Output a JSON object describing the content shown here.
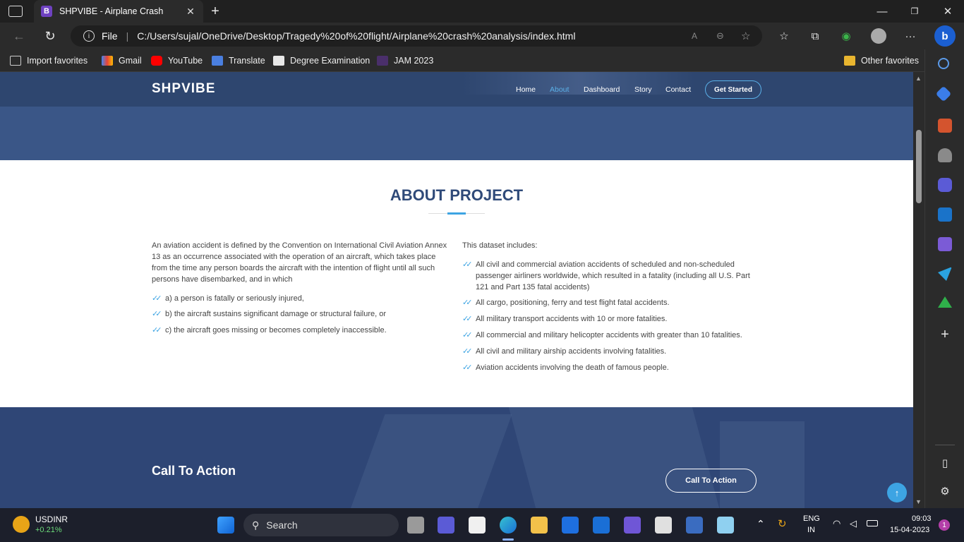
{
  "browser": {
    "tab_title": "SHPVIBE - Airplane Crash",
    "tab_favicon_letter": "B",
    "url_scheme": "File",
    "url": "C:/Users/sujal/OneDrive/Desktop/Tragedy%20of%20flight/Airplane%20crash%20analysis/index.html",
    "favorites": [
      "Import favorites",
      "Gmail",
      "YouTube",
      "Translate",
      "Degree Examination",
      "JAM 2023"
    ],
    "other_favorites": "Other favorites"
  },
  "site": {
    "logo": "SHPVIBE",
    "nav": [
      "Home",
      "About",
      "Dashboard",
      "Story",
      "Contact"
    ],
    "active_nav": "About",
    "cta_nav": "Get Started",
    "about_title": "ABOUT PROJECT",
    "left_para": "An aviation accident is defined by the Convention on International Civil Aviation Annex 13 as an occurrence associated with the operation of an aircraft, which takes place from the time any person boards the aircraft with the intention of flight until all such persons have disembarked, and in which",
    "left_items": [
      "a) a person is fatally or seriously injured,",
      "b) the aircraft sustains significant damage or structural failure, or",
      "c) the aircraft goes missing or becomes completely inaccessible."
    ],
    "right_intro": "This dataset includes:",
    "right_items": [
      "All civil and commercial aviation accidents of scheduled and non-scheduled passenger airliners worldwide, which resulted in a fatality (including all U.S. Part 121 and Part 135 fatal accidents)",
      "All cargo, positioning, ferry and test flight fatal accidents.",
      "All military transport accidents with 10 or more fatalities.",
      "All commercial and military helicopter accidents with greater than 10 fatalities.",
      "All civil and military airship accidents involving fatalities.",
      "Aviation accidents involving the death of famous people."
    ],
    "cta_title": "Call To Action",
    "cta_button": "Call To Action"
  },
  "taskbar": {
    "ticker_name": "USDINR",
    "ticker_change": "+0.21%",
    "search_label": "Search",
    "lang": "ENG",
    "region": "IN",
    "time": "09:03",
    "date": "15-04-2023",
    "notif_count": "1"
  },
  "colors": {
    "brand_navy": "#2f4a79",
    "accent_blue": "#3da4e3",
    "hero_blue": "#3a5687"
  }
}
